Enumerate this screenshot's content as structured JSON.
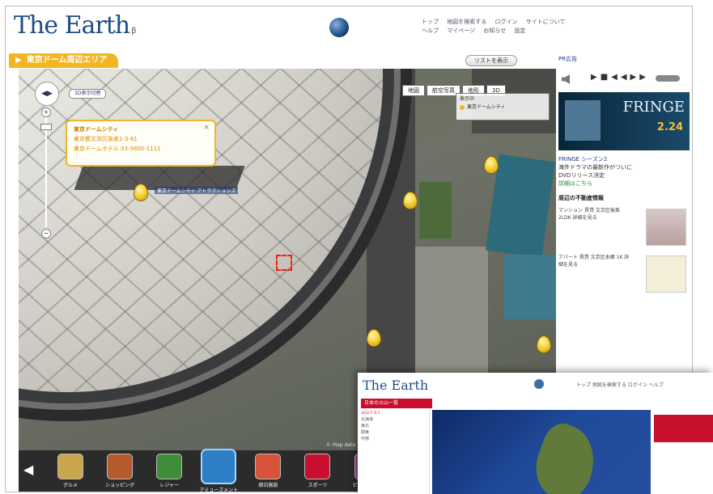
{
  "header": {
    "logo": "The Earth",
    "logo_sub": "β",
    "nav": [
      "トップ",
      "地図を検索する",
      "ログイン",
      "サイトについて",
      "ヘルプ",
      "マイページ",
      "お知らせ",
      "設定"
    ]
  },
  "titlebar": {
    "tab_label": "東京ドーム周辺エリア",
    "list_button": "リストを表示"
  },
  "map": {
    "nav_pill": "3D表示切替",
    "tools": [
      "地図",
      "航空写真",
      "地形",
      "3D"
    ],
    "legend_title": "表示中",
    "legend_item": "東京ドームシティ",
    "popup": {
      "title": "東京ドームシティ",
      "line1": "東京都文京区後楽1-3-61",
      "line2": "東京ドームホテル 03-5800-1111"
    },
    "pin_label": "東京ドームシティ アトラクションズ",
    "copyright": "© Map data"
  },
  "categories": [
    {
      "label": "グルメ",
      "color": "#c9a64b"
    },
    {
      "label": "ショッピング",
      "color": "#b55a2a"
    },
    {
      "label": "レジャー",
      "color": "#3f8c3a"
    },
    {
      "label": "アミューズメント",
      "color": "#2f7fc7",
      "selected": true
    },
    {
      "label": "宿泊施設",
      "color": "#d7543a"
    },
    {
      "label": "スポーツ",
      "color": "#c8102e"
    },
    {
      "label": "ビューティー",
      "color": "#b43c9a"
    }
  ],
  "sidebar": {
    "head": "PR広告",
    "ad_title": "FRINGE",
    "ad_date": "2.24",
    "ad_links": [
      "FRINGE シーズン2",
      "海外ドラマの最新作がついに",
      "DVDリリース決定",
      "詳細はこちら"
    ],
    "section_title": "周辺の不動産情報",
    "properties": [
      "マンション 賃貸 文京区後楽 2LDK 詳細を見る",
      "アパート 賃貸 文京区本郷 1K 詳細を見る"
    ]
  },
  "overlay": {
    "logo": "The Earth",
    "tab": "日本の火山一覧",
    "left_lines": [
      "火山リスト",
      "北海道",
      "東北",
      "関東",
      "中部"
    ],
    "nav": "トップ 地図を検索する ログイン ヘルプ"
  }
}
